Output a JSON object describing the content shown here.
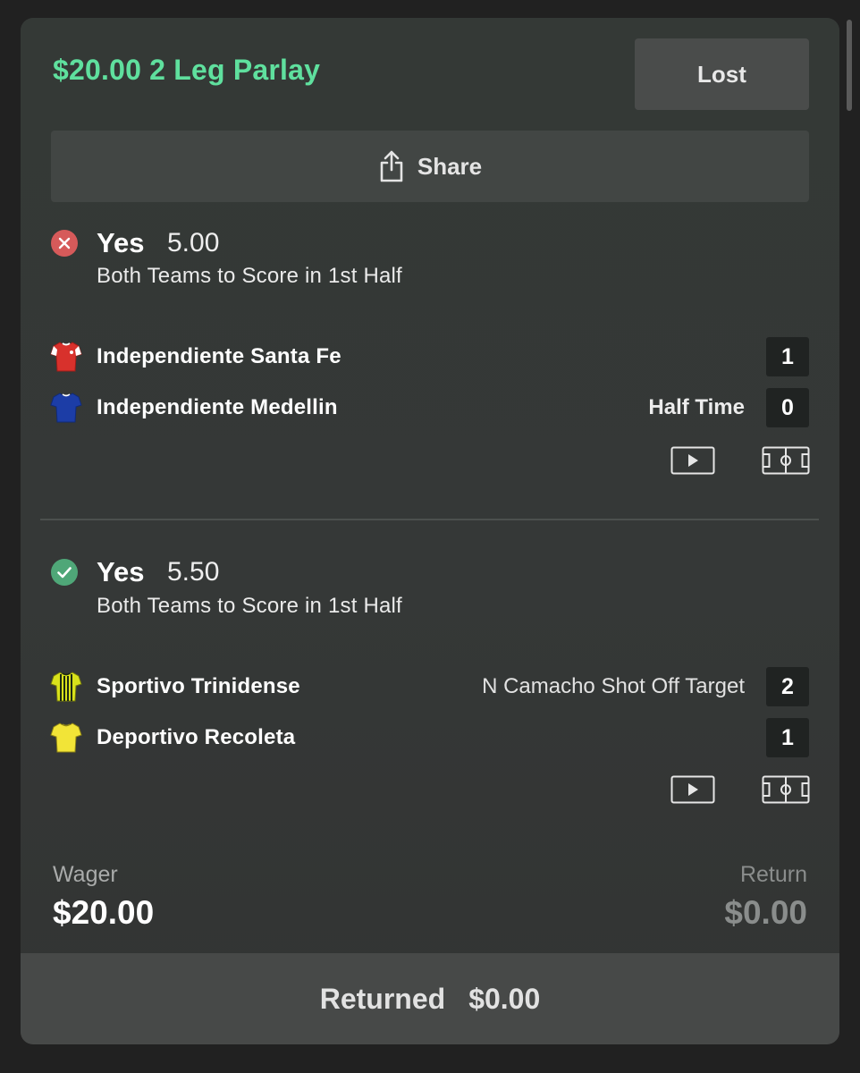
{
  "bet": {
    "title": "$20.00 2 Leg Parlay",
    "status": "Lost",
    "share_label": "Share"
  },
  "legs": [
    {
      "result": "lost",
      "selection": "Yes",
      "odds": "5.00",
      "market": "Both Teams to Score in 1st Half",
      "teams": [
        {
          "name": "Independiente Santa Fe",
          "score": "1",
          "info": "",
          "kit_color": "#d8312c"
        },
        {
          "name": "Independiente Medellin",
          "score": "0",
          "info": "Half Time",
          "kit_color": "#1c3da6"
        }
      ]
    },
    {
      "result": "won",
      "selection": "Yes",
      "odds": "5.50",
      "market": "Both Teams to Score in 1st Half",
      "teams": [
        {
          "name": "Sportivo Trinidense",
          "score": "2",
          "info": "N Camacho Shot Off Target",
          "kit_color": "#d9e21b"
        },
        {
          "name": "Deportivo Recoleta",
          "score": "1",
          "info": "",
          "kit_color": "#f2e437"
        }
      ]
    }
  ],
  "summary": {
    "wager_label": "Wager",
    "wager_value": "$20.00",
    "return_label": "Return",
    "return_value": "$0.00",
    "returned_label": "Returned",
    "returned_value": "$0.00"
  },
  "colors": {
    "accent_green": "#5fe09e",
    "lost_red": "#d65a5a",
    "won_green": "#4fa778"
  },
  "icons": [
    "share-icon",
    "lost-x-icon",
    "won-check-icon",
    "jersey-icon",
    "video-icon",
    "pitch-icon"
  ]
}
